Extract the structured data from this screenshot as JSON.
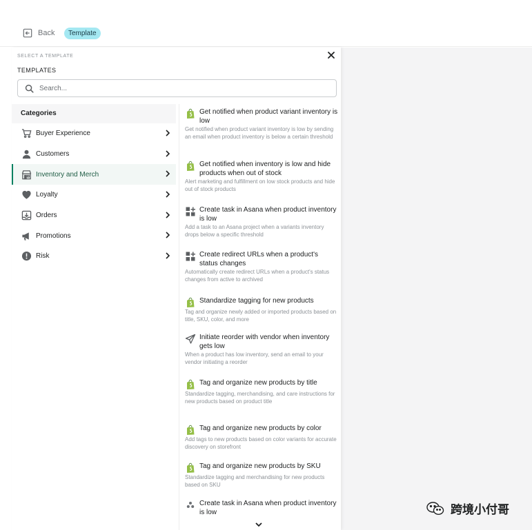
{
  "header": {
    "back_label": "Back",
    "badge_label": "Template"
  },
  "panel": {
    "select_label": "SELECT A TEMPLATE",
    "templates_label": "TEMPLATES"
  },
  "search": {
    "placeholder": "Search..."
  },
  "categories": {
    "heading": "Categories",
    "items": [
      {
        "label": "Buyer Experience",
        "icon": "cart-icon"
      },
      {
        "label": "Customers",
        "icon": "person-icon"
      },
      {
        "label": "Inventory and Merch",
        "icon": "store-icon",
        "active": true
      },
      {
        "label": "Loyalty",
        "icon": "heart-icon"
      },
      {
        "label": "Orders",
        "icon": "inbox-download-icon"
      },
      {
        "label": "Promotions",
        "icon": "megaphone-icon"
      },
      {
        "label": "Risk",
        "icon": "alert-circle-icon"
      }
    ]
  },
  "templates": [
    {
      "title": "Get notified when product variant inventory is low",
      "desc": "Get notified when product variant inventory is low by sending an email when product inventory is below a certain threshold",
      "icon": "shopify-bag-icon"
    },
    {
      "title": "Get notified when inventory is low and hide products when out of stock",
      "desc": "Alert marketing and fulfillment on low stock products and hide out of stock products",
      "icon": "shopify-bag-icon"
    },
    {
      "title": "Create task in Asana when product inventory is low",
      "desc": "Add a task to an Asana project when a variants inventory drops below a specific threshold",
      "icon": "apps-grid-icon"
    },
    {
      "title": "Create redirect URLs when a product's status changes",
      "desc": "Automatically create redirect URLs when a product's status changes from active to archived",
      "icon": "apps-grid-icon"
    },
    {
      "title": "Standardize tagging for new products",
      "desc": "Tag and organize newly added or imported products based on title, SKU, color, and more",
      "icon": "shopify-bag-icon"
    },
    {
      "title": "Initiate reorder with vendor when inventory gets low",
      "desc": "When a product has low inventory, send an email to your vendor initiating a reorder",
      "icon": "paper-plane-icon"
    },
    {
      "title": "Tag and organize new products by title",
      "desc": "Standardize tagging, merchandising, and care instructions for new products based on product title",
      "icon": "shopify-bag-icon"
    },
    {
      "title": "Tag and organize new products by color",
      "desc": "Add tags to new products based on color variants for accurate discovery on storefront",
      "icon": "shopify-bag-icon"
    },
    {
      "title": "Tag and organize new products by SKU",
      "desc": "Standardize tagging and merchandising for new products based on SKU",
      "icon": "shopify-bag-icon"
    },
    {
      "title": "Create task in Asana when product inventory is low",
      "desc": "",
      "icon": "asana-icon"
    }
  ],
  "watermark": {
    "text": "跨境小付哥"
  },
  "colors": {
    "accent": "#008060",
    "badge": "#a4e8f2",
    "shopify_green": "#95bf47"
  }
}
